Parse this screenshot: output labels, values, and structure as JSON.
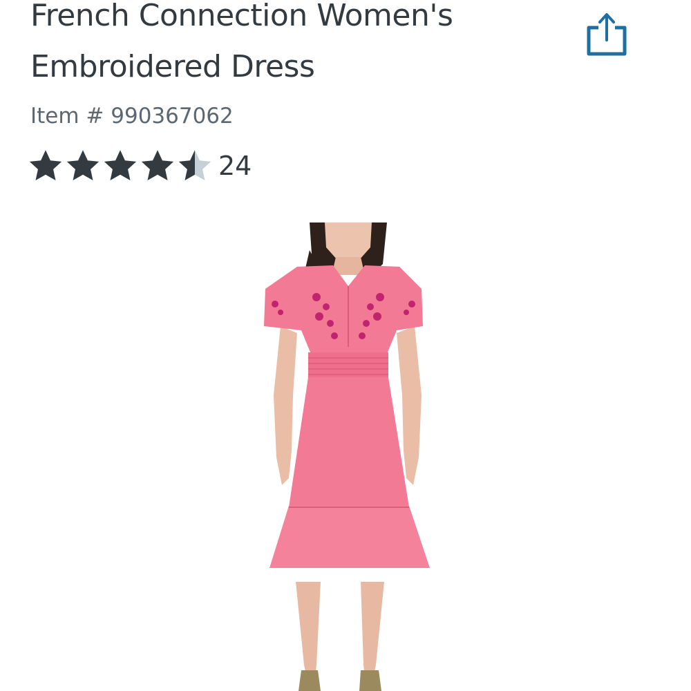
{
  "product": {
    "title": "French Connection Women's Embroidered Dress",
    "item_number": "Item # 990367062",
    "rating": {
      "stars": 4.5,
      "max_stars": 5,
      "review_count": "24"
    },
    "image_icon": "dress-photo"
  },
  "toolbar": {
    "share_icon": "share-icon"
  },
  "colors": {
    "text": "#333a40",
    "muted_text": "#5d6770",
    "star_filled": "#333a40",
    "star_empty": "#c6d0d8",
    "accent_blue": "#1f6fa3",
    "dress_pink": "#f27a94",
    "embroidery": "#c0246e"
  }
}
